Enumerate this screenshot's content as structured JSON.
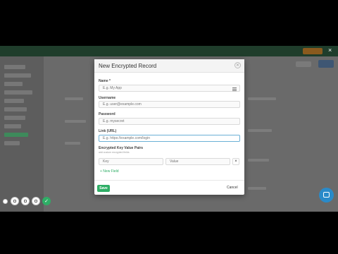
{
  "modal": {
    "title": "New Encrypted Record",
    "fields": {
      "name": {
        "label": "Name *",
        "placeholder": "E.g. My App"
      },
      "username": {
        "label": "Username",
        "placeholder": "E.g. user@example.com"
      },
      "password": {
        "label": "Password",
        "placeholder": "E.g. mysecret"
      },
      "link": {
        "label": "Link (URL)",
        "placeholder": "E.g. https://example.com/login"
      }
    },
    "kv": {
      "label": "Encrypted Key Value Pairs",
      "hint": "add custom encrypted fields",
      "key_placeholder": "Key",
      "value_placeholder": "Value"
    },
    "new_field": "+ New Field",
    "save": "Save",
    "cancel": "Cancel"
  },
  "icons": {
    "close": "close-icon",
    "list": "list-icon",
    "remove": "remove-icon",
    "chat": "chat-icon"
  },
  "colors": {
    "accent": "#2fae66",
    "chat": "#2a8ac9",
    "banner": "#1f3d2b"
  }
}
